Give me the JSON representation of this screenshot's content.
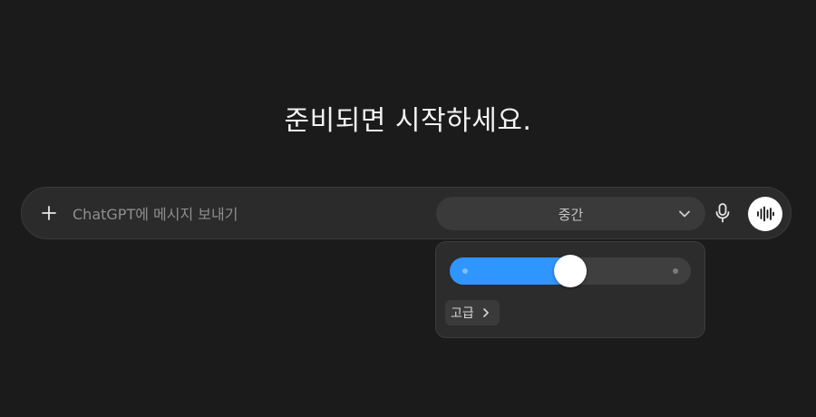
{
  "heading": "준비되면 시작하세요.",
  "composer": {
    "placeholder": "ChatGPT에 메시지 보내기",
    "value": "",
    "plus_icon": "plus-icon",
    "mic_icon": "mic-icon",
    "voice_icon": "waveform-icon"
  },
  "level_select": {
    "selected": "중간",
    "chevron_icon": "chevron-down-icon"
  },
  "popover": {
    "slider_fraction": 0.5,
    "advanced_label": "고급",
    "advanced_icon": "chevron-right-icon"
  },
  "colors": {
    "background": "#1b1b1b",
    "accent": "#2f95ff"
  }
}
